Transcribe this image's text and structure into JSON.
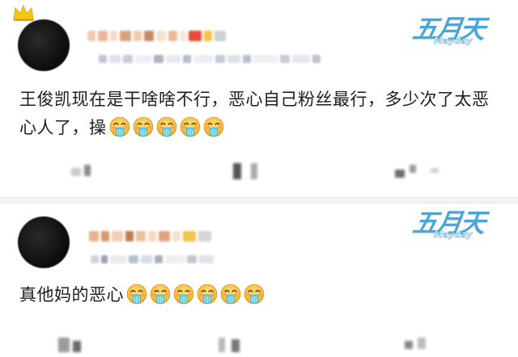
{
  "comments": [
    {
      "text": "王俊凯现在是干啥啥不行，恶心自己粉丝最行，多少次了太恶心人了，操",
      "emoji_icon": "nauseated-face-icon",
      "emoji_count": 5,
      "watermark": "五月天",
      "watermark_sub": "Mayday",
      "has_crown_badge": true
    },
    {
      "text": "真他妈的恶心",
      "emoji_icon": "nauseated-face-icon",
      "emoji_count": 6,
      "watermark": "五月天",
      "watermark_sub": "Mayday",
      "has_crown_badge": false
    }
  ],
  "colors": {
    "text": "#1d1d1d",
    "watermark": "#4aa6d9",
    "separator": "#f2f2f2",
    "avatar": "#0b0b0b"
  }
}
